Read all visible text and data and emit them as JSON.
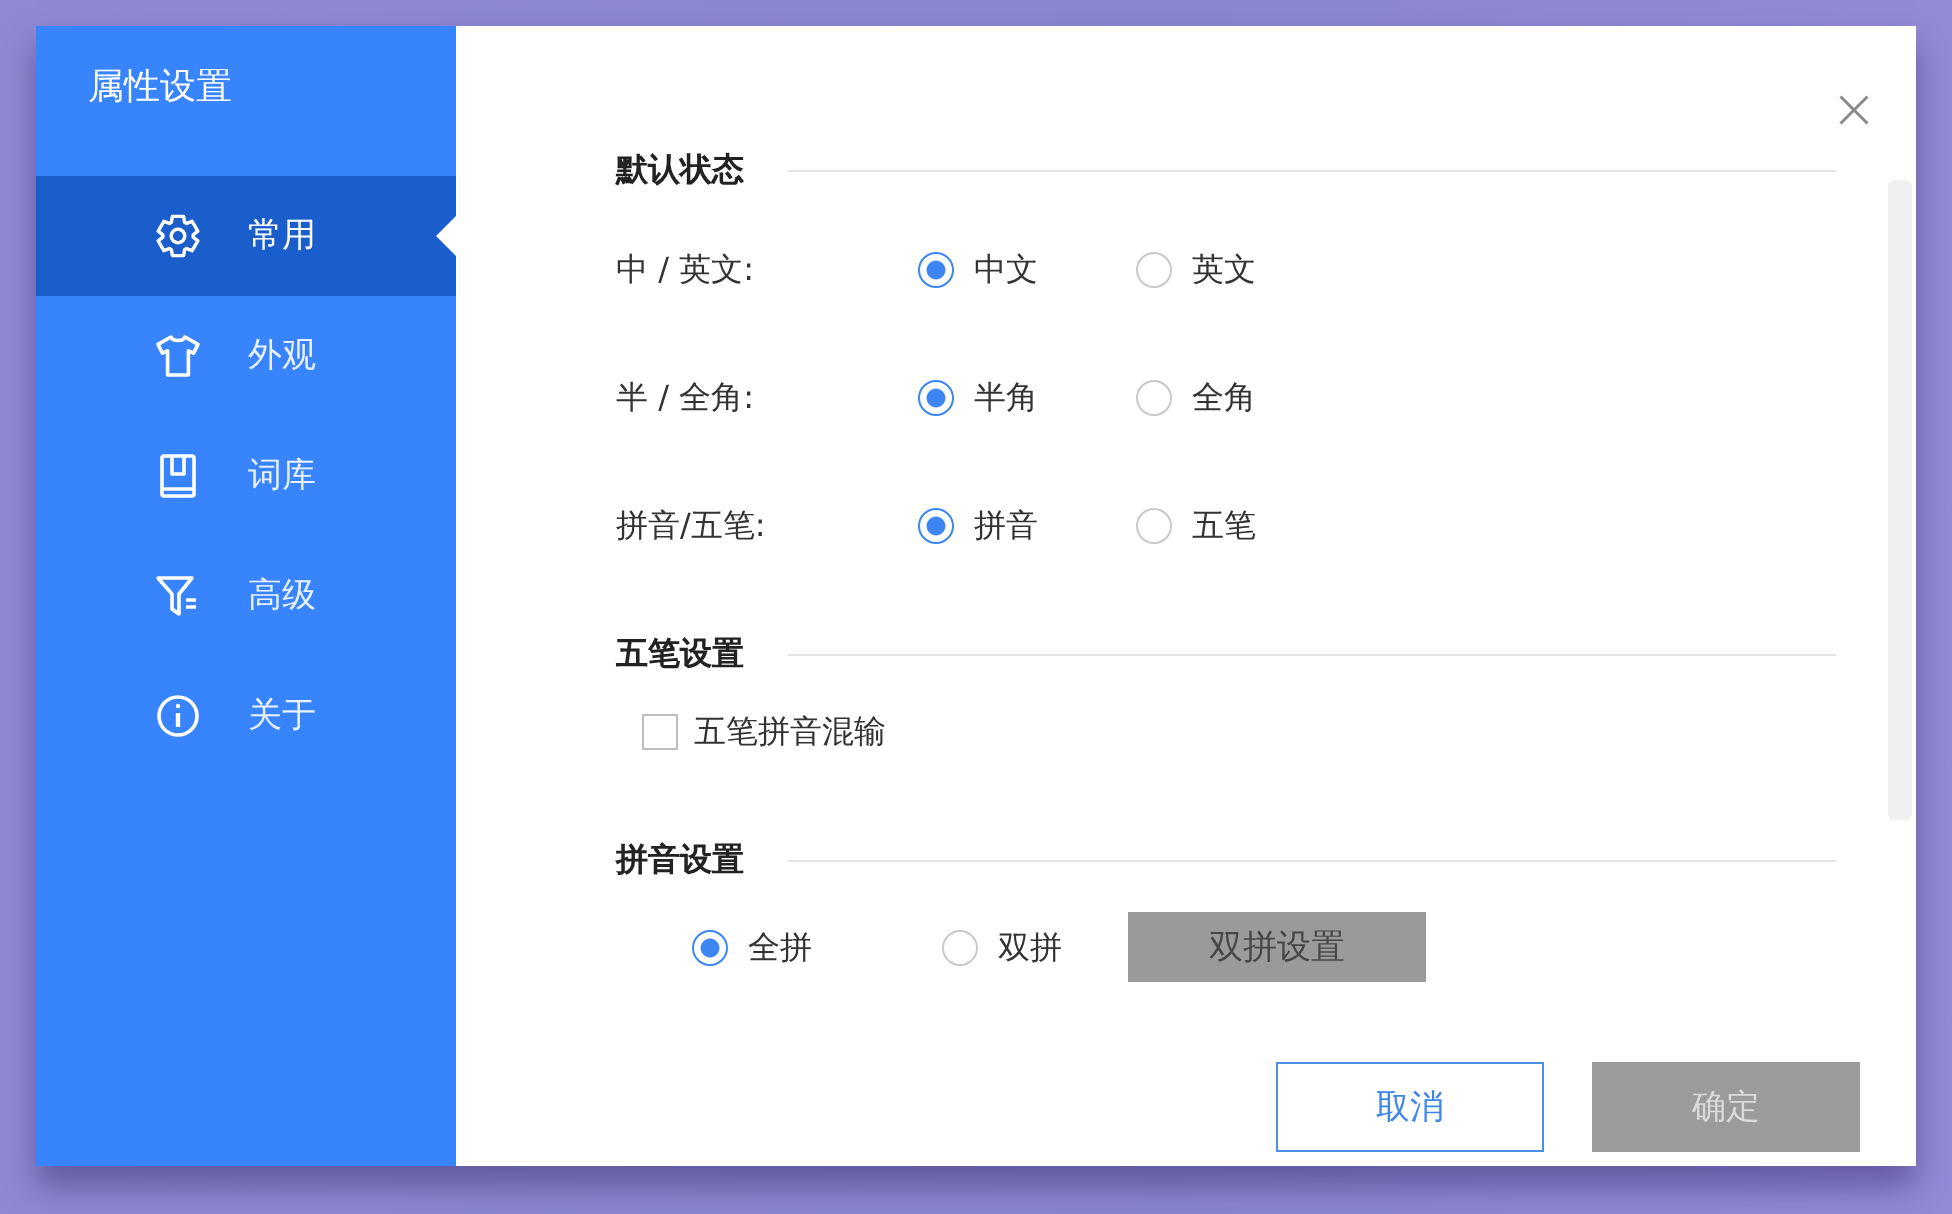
{
  "window": {
    "title": "属性设置"
  },
  "sidebar": {
    "items": [
      {
        "label": "常用",
        "selected": true
      },
      {
        "label": "外观",
        "selected": false
      },
      {
        "label": "词库",
        "selected": false
      },
      {
        "label": "高级",
        "selected": false
      },
      {
        "label": "关于",
        "selected": false
      }
    ]
  },
  "sections": [
    {
      "title": "默认状态",
      "items": [
        {
          "kind": "radio-group",
          "label": "中 / 英文:",
          "options": [
            {
              "label": "中文",
              "selected": true
            },
            {
              "label": "英文",
              "selected": false
            }
          ]
        },
        {
          "kind": "radio-group",
          "label": "半 / 全角:",
          "options": [
            {
              "label": "半角",
              "selected": true
            },
            {
              "label": "全角",
              "selected": false
            }
          ]
        },
        {
          "kind": "radio-group",
          "label": "拼音/五笔:",
          "options": [
            {
              "label": "拼音",
              "selected": true
            },
            {
              "label": "五笔",
              "selected": false
            }
          ]
        }
      ]
    },
    {
      "title": "五笔设置",
      "items": [
        {
          "kind": "checkbox",
          "label": "五笔拼音混输",
          "checked": false
        }
      ]
    },
    {
      "title": "拼音设置",
      "items": [
        {
          "kind": "radio-group",
          "options": [
            {
              "label": "全拼",
              "selected": true
            },
            {
              "label": "双拼",
              "selected": false
            }
          ],
          "button": "双拼设置"
        }
      ]
    }
  ],
  "buttons": [
    {
      "label": "取消",
      "kind": "outline",
      "disabled": false
    },
    {
      "label": "确定",
      "kind": "primary",
      "disabled": true
    }
  ]
}
